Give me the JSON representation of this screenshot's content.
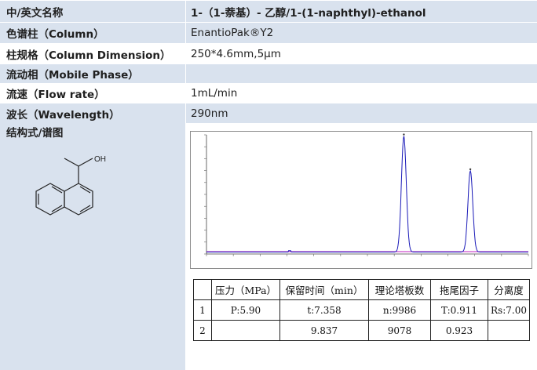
{
  "rows": [
    {
      "label": "中/英文名称",
      "value": "1-（1-萘基）- 乙醇/1-(1-naphthyl)-ethanol"
    },
    {
      "label": "色谱柱（Column）",
      "value": "EnantioPak®Y2"
    },
    {
      "label": "柱规格（Column Dimension）",
      "value": "250*4.6mm,5μm"
    },
    {
      "label": "流动相（Mobile Phase）",
      "value": ""
    },
    {
      "label": "流速（Flow rate）",
      "value": "1mL/min"
    },
    {
      "label": "波长（Wavelength）",
      "value": "290nm"
    }
  ],
  "structure_label": "结构式/谱图",
  "molecule": {
    "oh_label": "OH"
  },
  "chart_data": {
    "type": "line",
    "title": "",
    "xlabel": "",
    "ylabel": "",
    "series": [
      {
        "color": "#1a1ab8",
        "peaks": [
          {
            "x": 7.358,
            "height": 1.0
          },
          {
            "x": 9.837,
            "height": 0.7
          }
        ]
      },
      {
        "color": "#c020c0",
        "peaks": []
      }
    ],
    "xlim": [
      0,
      12
    ],
    "grid": false
  },
  "results": {
    "headers": [
      "",
      "压力（MPa）",
      "保留时间（min）",
      "理论塔板数",
      "拖尾因子",
      "分离度"
    ],
    "rows": [
      [
        "1",
        "P:5.90",
        "t:7.358",
        "n:9986",
        "T:0.911",
        "Rs:7.00"
      ],
      [
        "2",
        "",
        "9.837",
        "9078",
        "0.923",
        ""
      ]
    ]
  }
}
